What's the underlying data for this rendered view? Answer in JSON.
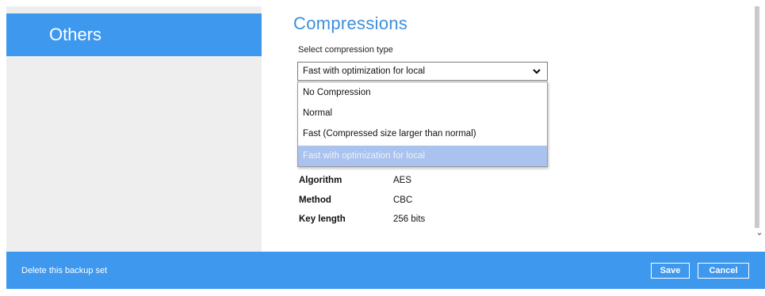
{
  "sidebar": {
    "active_item": "Others"
  },
  "compressions": {
    "title": "Compressions",
    "select_label": "Select compression type",
    "selected_value": "Fast with optimization for local",
    "options": [
      "No Compression",
      "Normal",
      "Fast (Compressed size larger than normal)",
      "Fast with optimization for local"
    ]
  },
  "encryption": {
    "rows": [
      {
        "label": "Algorithm",
        "value": "AES"
      },
      {
        "label": "Method",
        "value": "CBC"
      },
      {
        "label": "Key length",
        "value": "256 bits"
      }
    ]
  },
  "footer": {
    "delete_label": "Delete this backup set",
    "save_label": "Save",
    "cancel_label": "Cancel"
  },
  "icons": {
    "select_arrow": "chevron-down-icon",
    "scroll_down": "chevron-down-icon"
  },
  "colors": {
    "accent": "#3d98ee",
    "title": "#3d8fdc",
    "sidebar_bg": "#eeeeee",
    "option_highlight": "#a9c2ee"
  }
}
